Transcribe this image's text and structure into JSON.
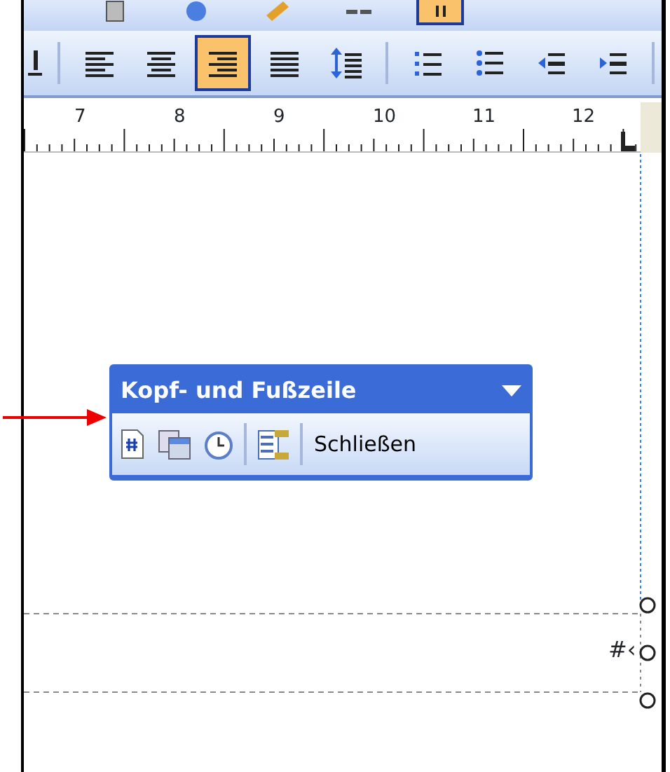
{
  "top_toolbar": {
    "buttons": [
      {
        "selected": false
      },
      {
        "selected": false
      },
      {
        "selected": false
      },
      {
        "selected": false
      },
      {
        "selected": true
      }
    ]
  },
  "format_toolbar": {
    "buttons": [
      {
        "kind": "button",
        "selected": false
      },
      {
        "kind": "separator"
      },
      {
        "kind": "button",
        "selected": false
      },
      {
        "kind": "button",
        "selected": false
      },
      {
        "kind": "button",
        "selected": true
      },
      {
        "kind": "button",
        "selected": false
      },
      {
        "kind": "button",
        "selected": false
      },
      {
        "kind": "separator"
      },
      {
        "kind": "button",
        "selected": false
      },
      {
        "kind": "button",
        "selected": false
      },
      {
        "kind": "button",
        "selected": false
      },
      {
        "kind": "button",
        "selected": false
      },
      {
        "kind": "separator"
      }
    ]
  },
  "ruler": {
    "labels": [
      "7",
      "8",
      "9",
      "10",
      "11",
      "12"
    ]
  },
  "floating_toolbar": {
    "title": "Kopf- und Fußzeile",
    "buttons": [
      {
        "kind": "icon"
      },
      {
        "kind": "icon"
      },
      {
        "kind": "icon"
      },
      {
        "kind": "separator"
      },
      {
        "kind": "icon"
      },
      {
        "kind": "separator"
      },
      {
        "kind": "text",
        "label": "Schließen"
      }
    ]
  },
  "footer": {
    "field_text": "#‹"
  }
}
